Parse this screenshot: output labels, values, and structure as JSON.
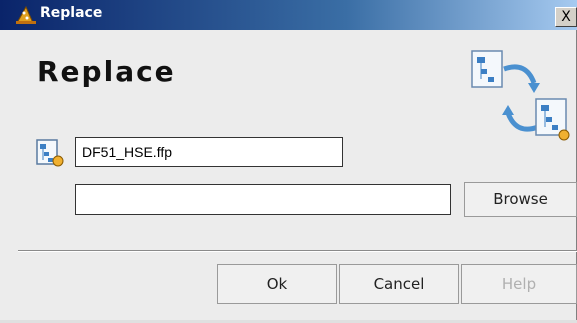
{
  "window": {
    "title": "Replace",
    "close_glyph": "X"
  },
  "dialog": {
    "heading": "Replace",
    "banner_icon": "replace-diagrams-icon",
    "file_icon": "diagram-file-icon",
    "file_value": "DF51_HSE.ffp",
    "path_value": "",
    "browse_label": "Browse"
  },
  "footer": {
    "ok_label": "Ok",
    "cancel_label": "Cancel",
    "help_label": "Help",
    "help_disabled": true
  },
  "colors": {
    "titlebar_start": "#0a246a",
    "titlebar_end": "#a6caf0",
    "dialog_background": "#ececec",
    "disabled_text": "#b0b0b0"
  }
}
